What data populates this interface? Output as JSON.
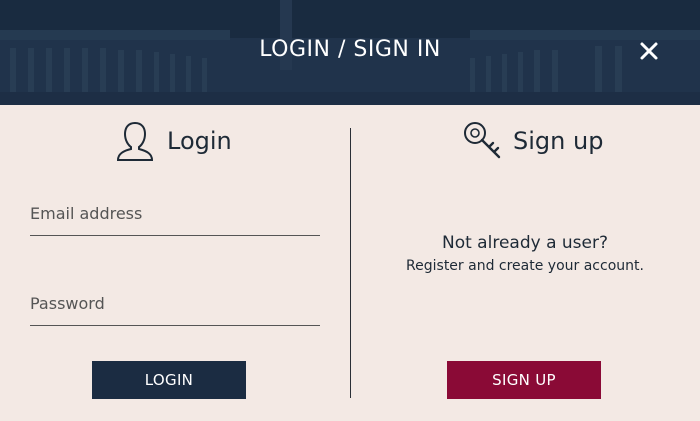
{
  "header": {
    "title": "LOGIN / SIGN IN",
    "close_icon": "close-icon"
  },
  "login": {
    "heading": "Login",
    "icon": "user-icon",
    "email_placeholder": "Email address",
    "password_placeholder": "Password",
    "button_label": "LOGIN"
  },
  "signup": {
    "heading": "Sign up",
    "icon": "key-icon",
    "question": "Not already a user?",
    "subtext": "Register and create your account.",
    "button_label": "SIGN UP"
  },
  "colors": {
    "header_bg": "#1b2c42",
    "login_button": "#1b2c42",
    "signup_button": "#8a0a36",
    "body_bg": "#f3e9e4"
  }
}
